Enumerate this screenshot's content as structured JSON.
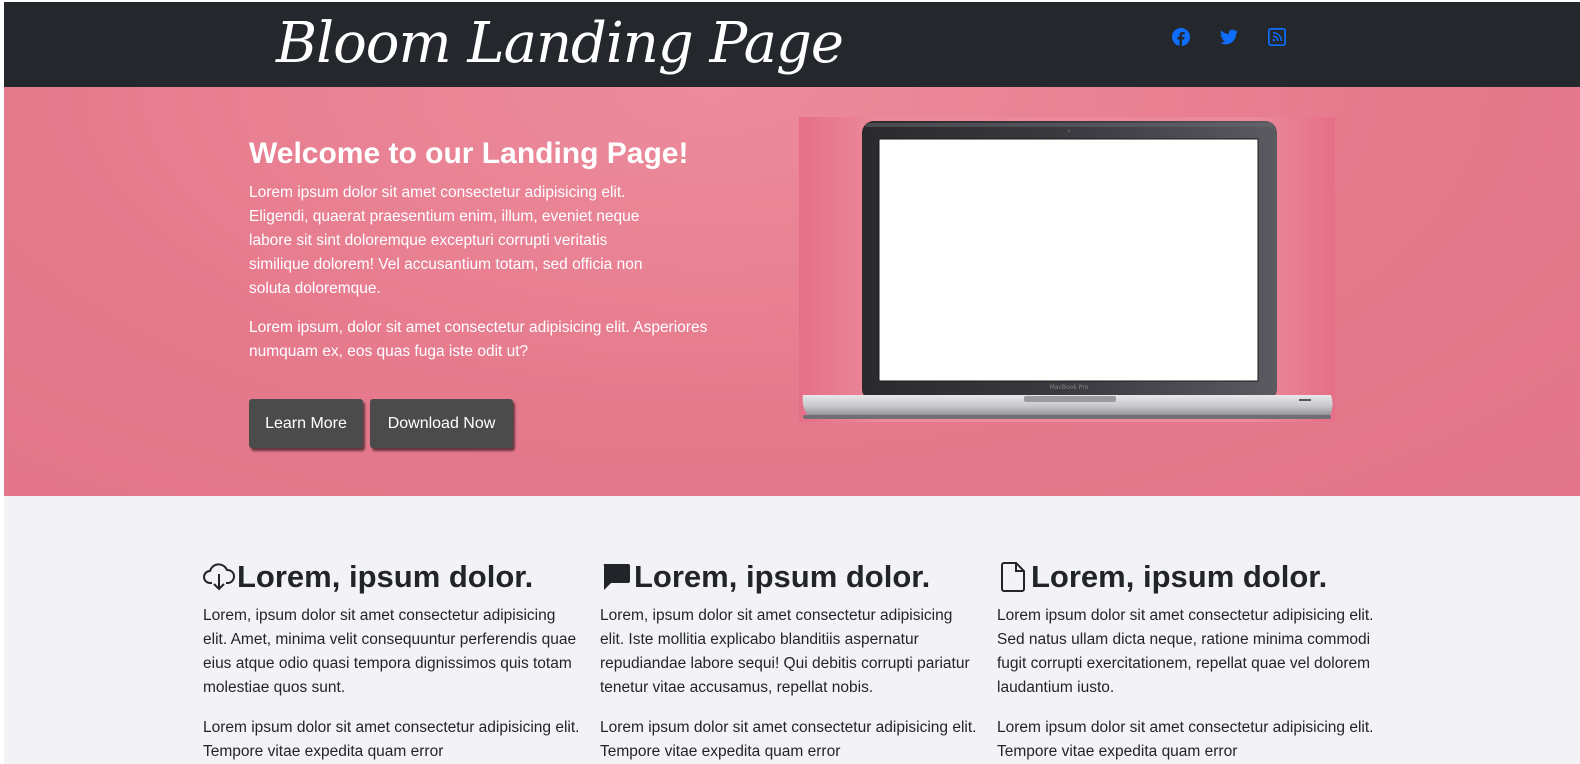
{
  "navbar": {
    "brand": "Bloom Landing Page",
    "social": [
      {
        "icon": "facebook-icon",
        "color": "#0d6efd"
      },
      {
        "icon": "twitter-icon",
        "color": "#0d6efd"
      },
      {
        "icon": "rss-icon",
        "color": "#0d6efd"
      }
    ]
  },
  "hero": {
    "title": "Welcome to our Landing Page!",
    "paragraph1": "Lorem ipsum dolor sit amet consectetur adipisicing elit. Eligendi, quaerat praesentium enim, illum, eveniet neque labore sit sint doloremque excepturi corrupti veritatis similique dolorem! Vel accusantium totam, sed officia non soluta doloremque.",
    "paragraph2": "Lorem ipsum, dolor sit amet consectetur adipisicing elit. Asperiores numquam ex, eos quas fuga iste odit ut?",
    "learn_more": "Learn More",
    "download_now": "Download Now",
    "image": "laptop-image"
  },
  "features": [
    {
      "icon": "cloud-download-icon",
      "heading": "Lorem, ipsum dolor.",
      "p1": "Lorem, ipsum dolor sit amet consectetur adipisicing elit. Amet, minima velit consequuntur perferendis quae eius atque odio quasi tempora dignissimos quis totam molestiae quos sunt.",
      "p2": "Lorem ipsum dolor sit amet consectetur adipisicing elit. Tempore vitae expedita quam error"
    },
    {
      "icon": "chat-icon",
      "heading": "Lorem, ipsum dolor.",
      "p1": "Lorem, ipsum dolor sit amet consectetur adipisicing elit. Iste mollitia explicabo blanditiis aspernatur repudiandae labore sequi! Qui debitis corrupti pariatur tenetur vitae accusamus, repellat nobis.",
      "p2": "Lorem ipsum dolor sit amet consectetur adipisicing elit. Tempore vitae expedita quam error"
    },
    {
      "icon": "file-icon",
      "heading": "Lorem, ipsum dolor.",
      "p1": "Lorem ipsum dolor sit amet consectetur adipisicing elit. Sed natus ullam dicta neque, ratione minima commodi fugit corrupti exercitationem, repellat quae vel dolorem laudantium iusto.",
      "p2": "Lorem ipsum dolor sit amet consectetur adipisicing elit. Tempore vitae expedita quam error"
    }
  ],
  "colors": {
    "navbar_bg": "#24272c",
    "hero_bg": "#e67a8d",
    "button_bg": "#4b4b4b",
    "link_blue": "#0d6efd",
    "page_bg": "#f3f3f5"
  }
}
